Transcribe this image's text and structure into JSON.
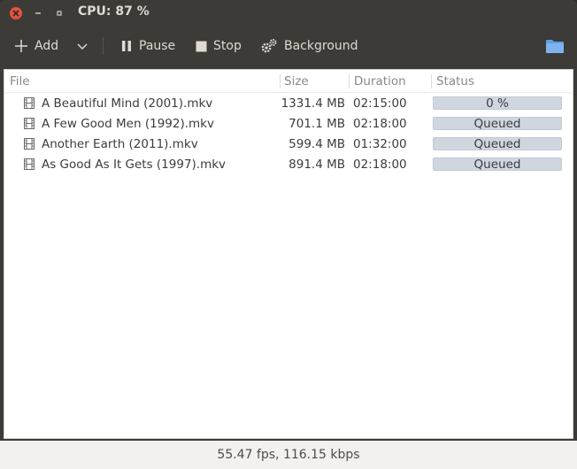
{
  "window": {
    "title": "CPU: 87 %"
  },
  "toolbar": {
    "add_label": "Add",
    "pause_label": "Pause",
    "stop_label": "Stop",
    "background_label": "Background"
  },
  "table": {
    "columns": [
      "File",
      "Size",
      "Duration",
      "Status"
    ],
    "rows": [
      {
        "file": "A Beautiful Mind (2001).mkv",
        "size": "1331.4 MB",
        "duration": "02:15:00",
        "status": "0 %",
        "progress": 0
      },
      {
        "file": "A Few Good Men (1992).mkv",
        "size": "701.1 MB",
        "duration": "02:18:00",
        "status": "Queued",
        "progress": 0
      },
      {
        "file": "Another Earth (2011).mkv",
        "size": "599.4 MB",
        "duration": "01:32:00",
        "status": "Queued",
        "progress": 0
      },
      {
        "file": "As Good As It Gets (1997).mkv",
        "size": "891.4 MB",
        "duration": "02:18:00",
        "status": "Queued",
        "progress": 0
      }
    ]
  },
  "footer": {
    "stats": "55.47 fps, 116.15 kbps"
  },
  "colors": {
    "titlebar_bg": "#3c3b37",
    "close_button": "#e5533b",
    "folder_accent": "#5e9ee8",
    "status_bar_bg": "#cfd6e0"
  }
}
